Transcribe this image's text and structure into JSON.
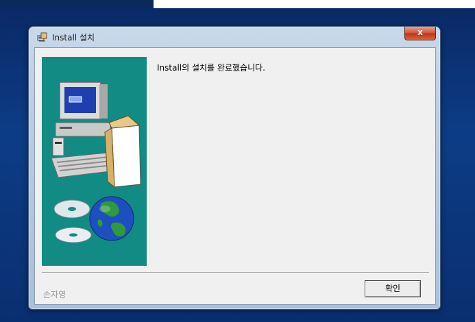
{
  "window": {
    "title": "Install 설치",
    "close_label": "x"
  },
  "main": {
    "message": "Install의 설치를 완료했습니다."
  },
  "footer": {
    "brand": "손자영",
    "ok_label": "확인"
  },
  "icons": {
    "title": "installer-icon",
    "close": "close-icon",
    "side": "computer-and-globe-illustration"
  },
  "colors": {
    "desktop": "#0d3c86",
    "side_panel": "#118b83",
    "close_button": "#c1351a"
  }
}
